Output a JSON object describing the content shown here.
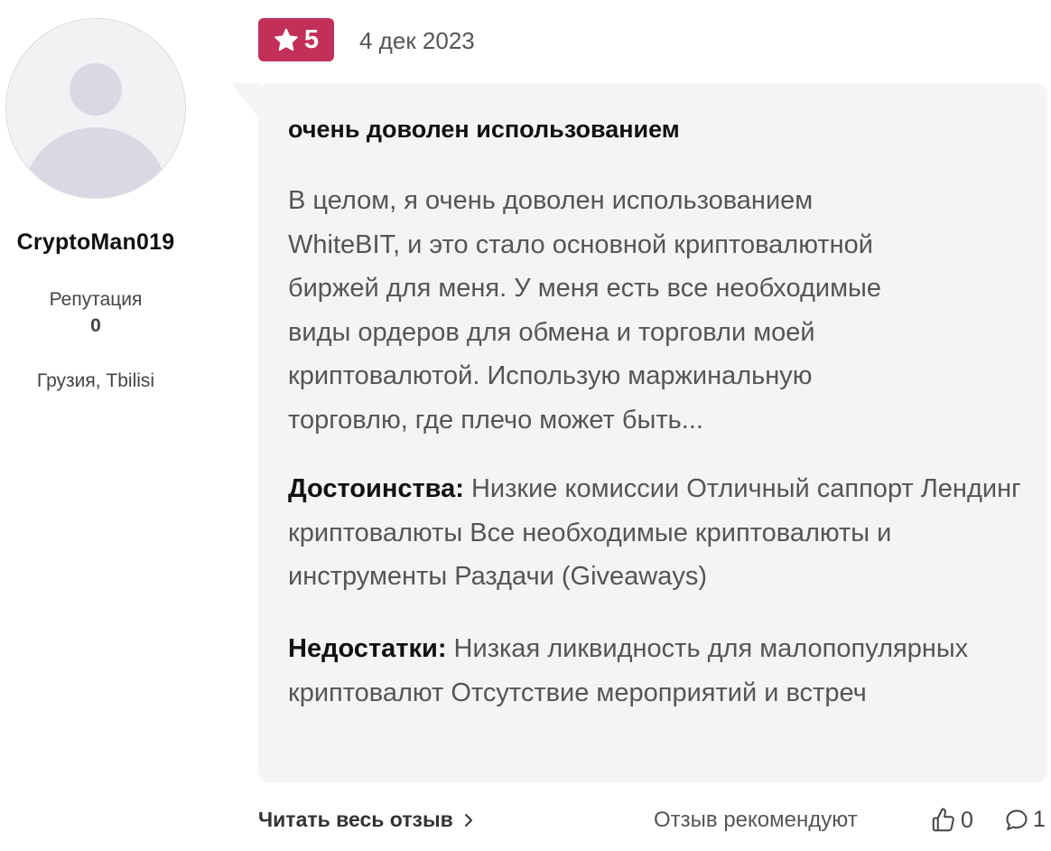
{
  "author": {
    "name": "CryptoMan019",
    "reputation_label": "Репутация",
    "reputation_value": "0",
    "location": "Грузия, Tbilisi",
    "avatar_icon": "user-placeholder-icon"
  },
  "review": {
    "rating": "5",
    "rating_icon": "star-icon",
    "date": "4 дек 2023",
    "title": "очень доволен использованием",
    "text_lines": [
      "В целом, я очень доволен использованием",
      "WhiteBIT, и это стало основной криптовалютной",
      "биржей для меня. У меня есть все необходимые",
      "виды ордеров для обмена и торговли моей",
      "криптовалютой. Использую маржинальную",
      "торговлю, где плечо может быть..."
    ],
    "pros_label": "Достоинства:",
    "pros_text": "Низкие комиссии Отличный саппорт Лендинг криптовалюты Все необходимые криптовалюты и инструменты Раздачи (Giveaways)",
    "cons_label": "Недостатки:",
    "cons_text": "Низкая ликвидность для малопопулярных криптовалют Отсутствие мероприятий и встреч"
  },
  "footer": {
    "read_more": "Читать весь отзыв",
    "recommend_label": "Отзыв рекомендуют",
    "likes_count": "0",
    "comments_count": "1"
  },
  "colors": {
    "badge": "#c2305a",
    "bubble": "#f4f4f6",
    "muted_text": "#555555"
  }
}
